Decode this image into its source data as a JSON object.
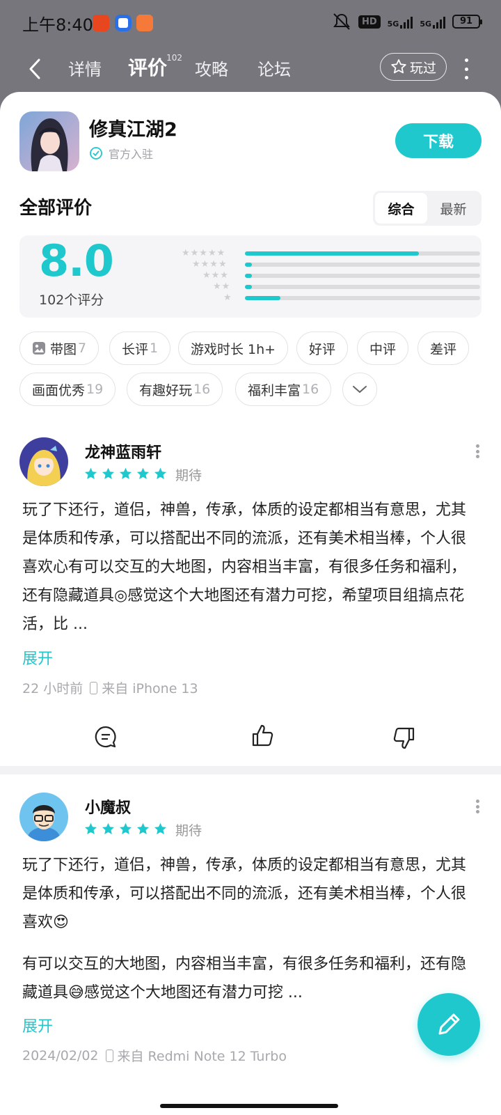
{
  "status_bar": {
    "time": "上午8:40",
    "hd_label": "HD",
    "net1": "5G",
    "net2": "5G",
    "battery": "91"
  },
  "nav": {
    "tabs": [
      "详情",
      "评价",
      "攻略",
      "论坛"
    ],
    "active_tab": "评价",
    "review_count_sup": "102",
    "played_label": "玩过"
  },
  "game": {
    "title": "修真江湖2",
    "official_label": "官方入驻",
    "download_label": "下载"
  },
  "reviews_header": {
    "title": "全部评价",
    "sort_options": [
      "综合",
      "最新"
    ],
    "active_sort": "综合"
  },
  "rating": {
    "score": "8.0",
    "count_label": "102个评分",
    "distribution": [
      {
        "stars": 5,
        "fraction": 0.74
      },
      {
        "stars": 4,
        "fraction": 0.03
      },
      {
        "stars": 3,
        "fraction": 0.03
      },
      {
        "stars": 2,
        "fraction": 0.03
      },
      {
        "stars": 1,
        "fraction": 0.15
      }
    ]
  },
  "filters": {
    "row1": [
      {
        "label": "带图",
        "count": "7",
        "icon": "image-icon"
      },
      {
        "label": "长评",
        "count": "1"
      },
      {
        "label": "游戏时长 1h+",
        "count": ""
      },
      {
        "label": "好评",
        "count": ""
      },
      {
        "label": "中评",
        "count": ""
      },
      {
        "label": "差评",
        "count": ""
      }
    ],
    "row2": [
      {
        "label": "画面优秀",
        "count": "19"
      },
      {
        "label": "有趣好玩",
        "count": "16"
      },
      {
        "label": "福利丰富",
        "count": "16"
      }
    ]
  },
  "reviews": [
    {
      "user": "龙神蓝雨轩",
      "stars": 5,
      "tag": "期待",
      "text": "玩了下还行，道侣，神兽，传承，体质的设定都相当有意思，尤其是体质和传承，可以搭配出不同的流派，还有美术相当棒，个人很喜欢心有可以交互的大地图，内容相当丰富，有很多任务和福利，还有隐藏道具◎感觉这个大地图还有潜力可挖，希望项目组搞点花活，比 ...",
      "expand_label": "展开",
      "time": "22 小时前",
      "device": "来自 iPhone 13"
    },
    {
      "user": "小魔叔",
      "stars": 5,
      "tag": "期待",
      "text_p1": "玩了下还行，道侣，神兽，传承，体质的设定都相当有意思，尤其是体质和传承，可以搭配出不同的流派，还有美术相当棒，个人很喜欢😍",
      "text_p2": "有可以交互的大地图，内容相当丰富，有很多任务和福利，还有隐藏道具😅感觉这个大地图还有潜力可挖 ...",
      "expand_label": "展开",
      "time": "2024/02/02",
      "device": "来自 Redmi Note 12 Turbo"
    }
  ],
  "colors": {
    "accent": "#1ec8cd",
    "header_bg": "#76767c"
  }
}
